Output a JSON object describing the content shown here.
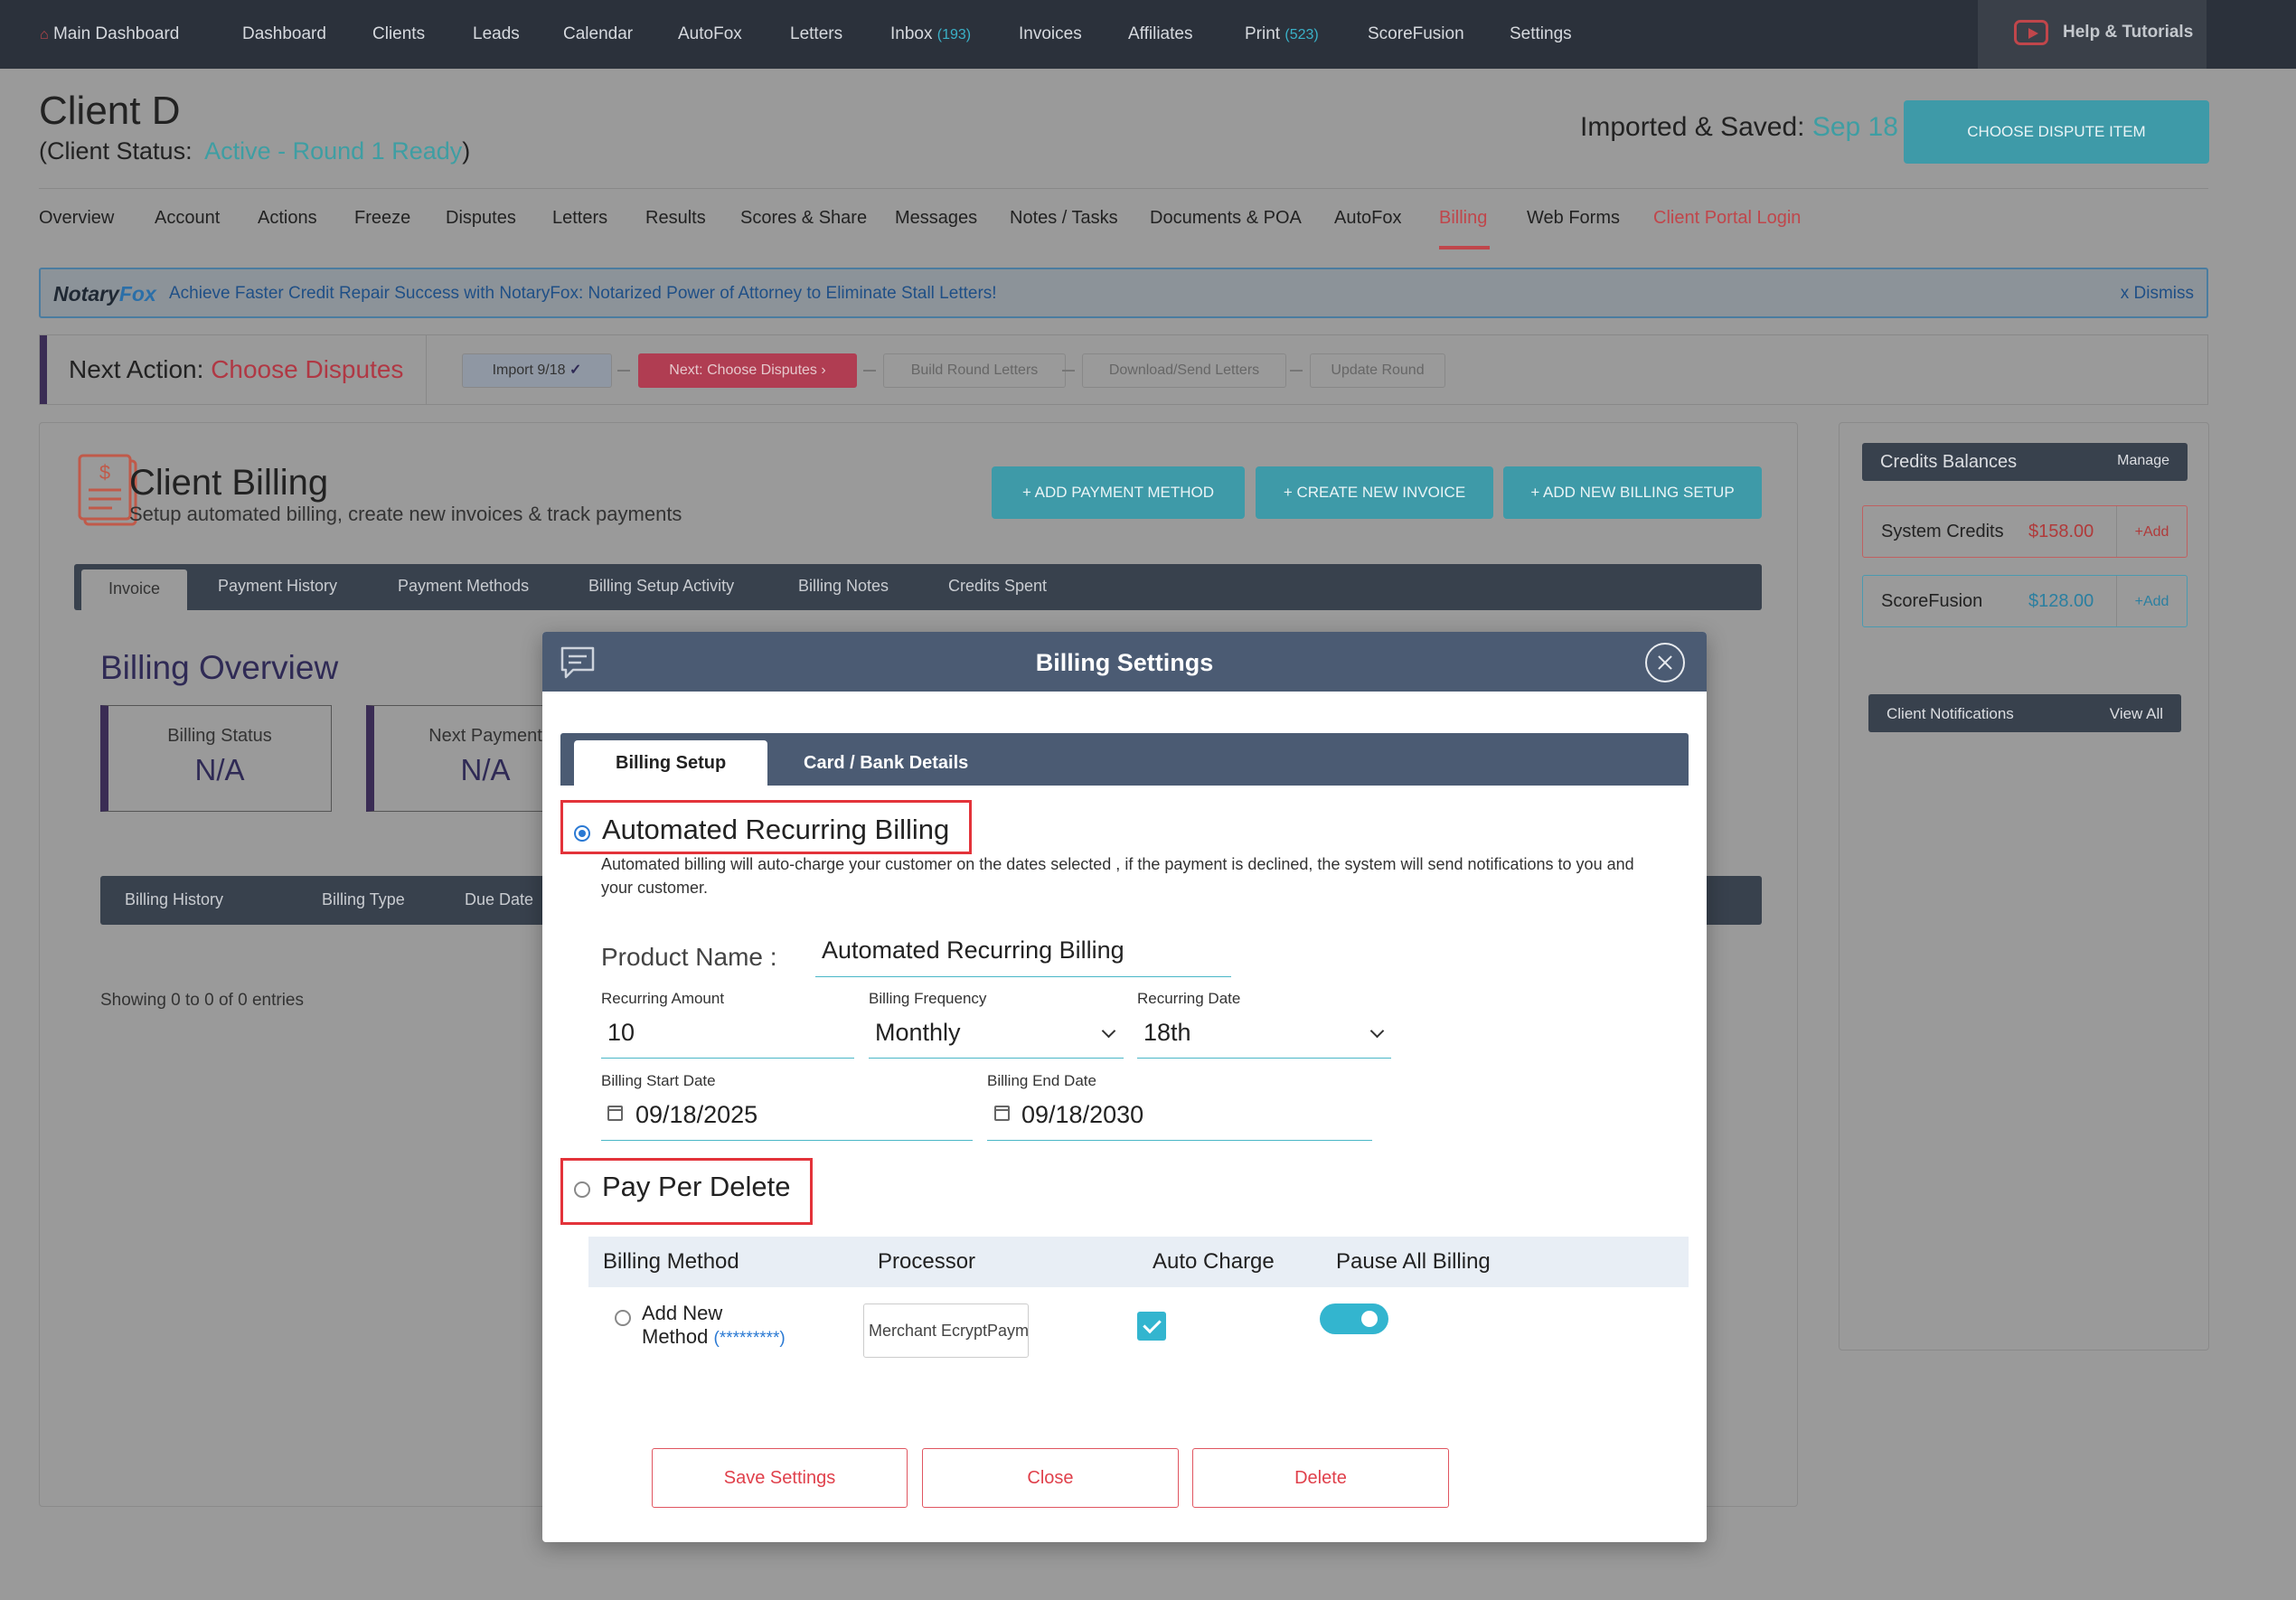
{
  "topnav": {
    "items": [
      {
        "label": "Main Dashboard"
      },
      {
        "label": "Dashboard"
      },
      {
        "label": "Clients"
      },
      {
        "label": "Leads"
      },
      {
        "label": "Calendar"
      },
      {
        "label": "AutoFox"
      },
      {
        "label": "Letters"
      },
      {
        "label": "Inbox",
        "count": "(193)"
      },
      {
        "label": "Invoices"
      },
      {
        "label": "Affiliates"
      },
      {
        "label": "Print",
        "count": "(523)"
      },
      {
        "label": "ScoreFusion"
      },
      {
        "label": "Settings"
      }
    ],
    "help": "Help & Tutorials"
  },
  "header": {
    "client_name": "Client D",
    "status_prefix": "(Client Status:",
    "status_value": "Active - Round 1 Ready",
    "status_suffix": ")",
    "imported_label": "Imported & Saved:",
    "imported_date": "Sep 18",
    "choose_button": "CHOOSE DISPUTE ITEM"
  },
  "client_tabs": [
    "Overview",
    "Account",
    "Actions",
    "Freeze",
    "Disputes",
    "Letters",
    "Results",
    "Scores & Share",
    "Messages",
    "Notes / Tasks",
    "Documents & POA",
    "AutoFox",
    "Billing",
    "Web Forms",
    "Client Portal Login"
  ],
  "banner": {
    "logo_a": "Notary",
    "logo_b": "Fox",
    "message": "Achieve Faster Credit Repair Success with NotaryFox: Notarized Power of Attorney to Eliminate Stall Letters!",
    "dismiss": "x Dismiss"
  },
  "next_action": {
    "label": "Next Action:",
    "value": "Choose Disputes",
    "steps": [
      "Import 9/18",
      "Next: Choose Disputes",
      "Build Round Letters",
      "Download/Send Letters",
      "Update Round"
    ]
  },
  "billing": {
    "title": "Client Billing",
    "subtitle": "Setup automated billing, create new invoices & track payments",
    "buttons": [
      "+ ADD PAYMENT METHOD",
      "+ CREATE NEW INVOICE",
      "+ ADD NEW BILLING SETUP"
    ],
    "tabs": [
      "Invoice",
      "Payment History",
      "Payment Methods",
      "Billing Setup Activity",
      "Billing Notes",
      "Credits Spent"
    ],
    "overview_title": "Billing Overview",
    "cards": [
      {
        "label": "Billing Status",
        "value": "N/A"
      },
      {
        "label": "Next Payment",
        "value": "N/A"
      }
    ],
    "history_columns": [
      "Billing History",
      "Billing Type",
      "Due Date"
    ],
    "showing": "Showing 0 to 0 of 0 entries"
  },
  "credits": {
    "title": "Credits Balances",
    "manage": "Manage",
    "rows": [
      {
        "name": "System Credits",
        "amount": "$158.00",
        "add": "+Add"
      },
      {
        "name": "ScoreFusion",
        "amount": "$128.00",
        "add": "+Add"
      }
    ]
  },
  "notifications": {
    "title": "Client Notifications",
    "view_all": "View All"
  },
  "modal": {
    "title": "Billing Settings",
    "tabs": [
      "Billing Setup",
      "Card / Bank Details"
    ],
    "auto_title": "Automated Recurring Billing",
    "auto_desc": "Automated billing will auto-charge your customer on the dates selected , if the payment is declined, the system will send notifications to you and your customer.",
    "product_label": "Product Name :",
    "product_value": "Automated Recurring Billing",
    "recurring_amount_label": "Recurring Amount",
    "recurring_amount": "10",
    "frequency_label": "Billing Frequency",
    "frequency": "Monthly",
    "recurring_date_label": "Recurring Date",
    "recurring_date": "18th",
    "start_label": "Billing Start Date",
    "start_date": "09/18/2025",
    "end_label": "Billing End Date",
    "end_date": "09/18/2030",
    "ppd_title": "Pay Per Delete",
    "table_headers": [
      "Billing Method",
      "Processor",
      "Auto Charge",
      "Pause All Billing"
    ],
    "method_line1": "Add New",
    "method_line2": "Method",
    "method_mask": "(*********)",
    "processor": "Merchant EcryptPayment",
    "buttons": [
      "Save Settings",
      "Close",
      "Delete"
    ]
  },
  "colors": {
    "accent_teal": "#3e9aa8",
    "danger": "#e3333a",
    "nav_dark": "#2b313b",
    "modal_header": "#4b5b73"
  }
}
